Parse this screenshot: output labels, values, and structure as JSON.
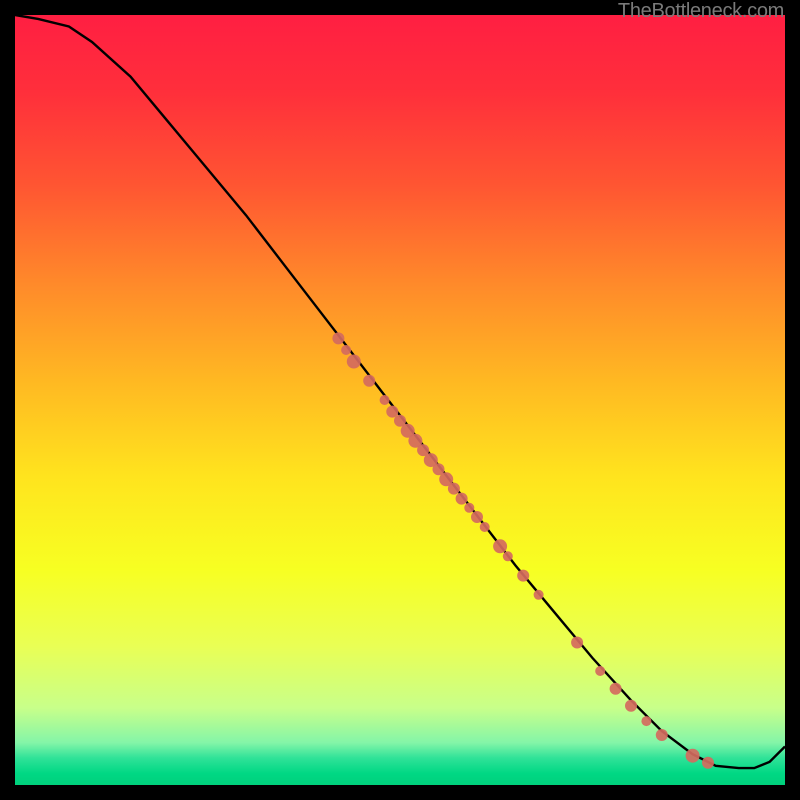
{
  "attribution": "TheBottleneck.com",
  "chart_data": {
    "type": "line",
    "title": "",
    "xlabel": "",
    "ylabel": "",
    "xlim": [
      0,
      100
    ],
    "ylim": [
      0,
      100
    ],
    "series": [
      {
        "name": "curve",
        "x": [
          0,
          3,
          7,
          10,
          15,
          20,
          25,
          30,
          35,
          40,
          45,
          50,
          55,
          60,
          65,
          70,
          75,
          80,
          84,
          88,
          91,
          94,
          96,
          98,
          100
        ],
        "y": [
          100,
          99.5,
          98.5,
          96.5,
          92,
          86,
          80,
          74,
          67.5,
          61,
          54.5,
          48,
          41.5,
          35,
          28.5,
          22.5,
          16.5,
          11,
          7,
          4,
          2.5,
          2.2,
          2.2,
          3,
          5
        ]
      }
    ],
    "markers": [
      {
        "x": 42,
        "y": 58,
        "r": 6
      },
      {
        "x": 43,
        "y": 56.5,
        "r": 5
      },
      {
        "x": 44,
        "y": 55,
        "r": 7
      },
      {
        "x": 46,
        "y": 52.5,
        "r": 6
      },
      {
        "x": 48,
        "y": 50,
        "r": 5
      },
      {
        "x": 49,
        "y": 48.5,
        "r": 6
      },
      {
        "x": 50,
        "y": 47.3,
        "r": 6
      },
      {
        "x": 51,
        "y": 46,
        "r": 7
      },
      {
        "x": 52,
        "y": 44.7,
        "r": 7
      },
      {
        "x": 53,
        "y": 43.5,
        "r": 6
      },
      {
        "x": 54,
        "y": 42.2,
        "r": 7
      },
      {
        "x": 55,
        "y": 41,
        "r": 6
      },
      {
        "x": 56,
        "y": 39.7,
        "r": 7
      },
      {
        "x": 57,
        "y": 38.5,
        "r": 6
      },
      {
        "x": 58,
        "y": 37.2,
        "r": 6
      },
      {
        "x": 59,
        "y": 36,
        "r": 5
      },
      {
        "x": 60,
        "y": 34.8,
        "r": 6
      },
      {
        "x": 61,
        "y": 33.5,
        "r": 5
      },
      {
        "x": 63,
        "y": 31,
        "r": 7
      },
      {
        "x": 64,
        "y": 29.7,
        "r": 5
      },
      {
        "x": 66,
        "y": 27.2,
        "r": 6
      },
      {
        "x": 68,
        "y": 24.7,
        "r": 5
      },
      {
        "x": 73,
        "y": 18.5,
        "r": 6
      },
      {
        "x": 76,
        "y": 14.8,
        "r": 5
      },
      {
        "x": 78,
        "y": 12.5,
        "r": 6
      },
      {
        "x": 80,
        "y": 10.3,
        "r": 6
      },
      {
        "x": 82,
        "y": 8.3,
        "r": 5
      },
      {
        "x": 84,
        "y": 6.5,
        "r": 6
      },
      {
        "x": 88,
        "y": 3.8,
        "r": 7
      },
      {
        "x": 90,
        "y": 2.9,
        "r": 6
      }
    ],
    "gradient_stops": [
      {
        "offset": 0.0,
        "color": "#ff1f42"
      },
      {
        "offset": 0.1,
        "color": "#ff2f3b"
      },
      {
        "offset": 0.22,
        "color": "#ff5532"
      },
      {
        "offset": 0.35,
        "color": "#ff8a2a"
      },
      {
        "offset": 0.48,
        "color": "#ffba22"
      },
      {
        "offset": 0.6,
        "color": "#ffe41e"
      },
      {
        "offset": 0.72,
        "color": "#f7ff22"
      },
      {
        "offset": 0.82,
        "color": "#e9ff55"
      },
      {
        "offset": 0.9,
        "color": "#c8ff8a"
      },
      {
        "offset": 0.945,
        "color": "#84f5a8"
      },
      {
        "offset": 0.965,
        "color": "#2fe298"
      },
      {
        "offset": 0.985,
        "color": "#00d884"
      },
      {
        "offset": 1.0,
        "color": "#00d07c"
      }
    ],
    "marker_color": "#d46a5e",
    "line_color": "#000000"
  }
}
